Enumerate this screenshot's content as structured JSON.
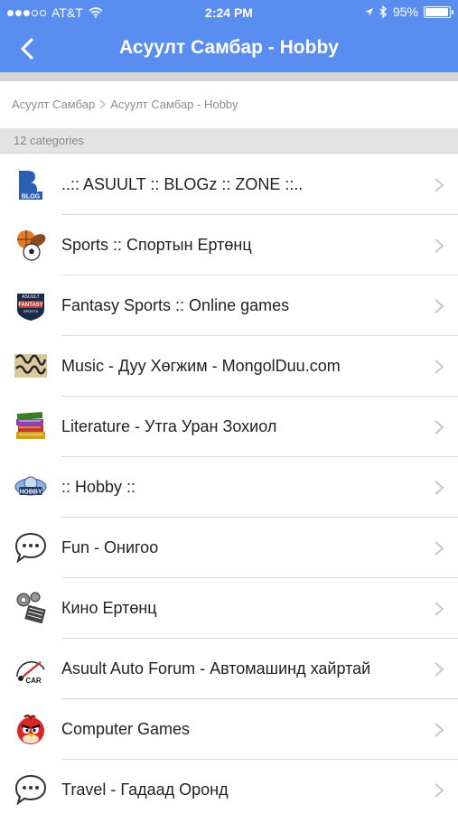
{
  "status_bar": {
    "carrier": "AT&T",
    "time": "2:24 PM",
    "battery": "95%",
    "battery_level": 0.95,
    "icons": [
      "signal-dots",
      "wifi-icon",
      "location-icon",
      "bluetooth-icon",
      "battery-icon"
    ]
  },
  "nav": {
    "title": "Асуулт Самбар - Hobby",
    "back_icon": "chevron-left-icon"
  },
  "breadcrumb": {
    "items": [
      "Асуулт Самбар",
      "Асуулт Самбар - Hobby"
    ]
  },
  "categories_header": "12 categories",
  "colors": {
    "nav_bg": "#5a8df0",
    "section_bg": "#e3e3e3",
    "separator": "#dcdcdc"
  },
  "categories": [
    {
      "label": "..:: ASUULT :: BLOGz :: ZONE ::..",
      "icon": "blog-icon"
    },
    {
      "label": "Sports :: Спортын Ертөнц",
      "icon": "sports-balls-icon"
    },
    {
      "label": "Fantasy Sports :: Online games",
      "icon": "fantasy-sports-icon"
    },
    {
      "label": "Music - Дуу Хөгжим - MongolDuu.com",
      "icon": "music-icon"
    },
    {
      "label": "Literature - Утга Уран Зохиол",
      "icon": "books-icon"
    },
    {
      "label": ":: Hobby ::",
      "icon": "hobby-icon"
    },
    {
      "label": "Fun - Онигоо",
      "icon": "speech-bubble-icon"
    },
    {
      "label": "Кино Ертөнц",
      "icon": "film-reel-icon"
    },
    {
      "label": "Asuult Auto Forum - Автомашинд хайртай",
      "icon": "car-icon"
    },
    {
      "label": "Computer Games",
      "icon": "angry-bird-icon"
    },
    {
      "label": "Travel - Гадаад Оронд",
      "icon": "speech-bubble-icon"
    }
  ]
}
